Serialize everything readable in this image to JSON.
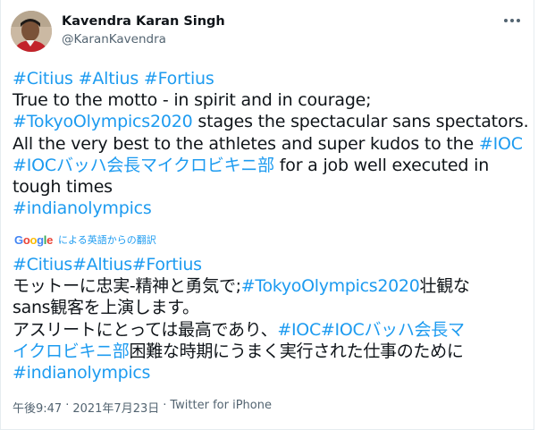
{
  "author": {
    "name": "Kavendra Karan Singh",
    "handle": "@KaranKavendra",
    "avatar_icon": "profile-photo",
    "avatar_colors": [
      "#c9b8a6",
      "#6b4a35",
      "#c2232b",
      "#222222"
    ]
  },
  "more_icon": "more-horizontal-icon",
  "tweet": {
    "lines": [
      [
        {
          "t": "#Citius",
          "tag": true
        },
        {
          "t": " ",
          "tag": false
        },
        {
          "t": "#Altius",
          "tag": true
        },
        {
          "t": " ",
          "tag": false
        },
        {
          "t": "#Fortius",
          "tag": true
        }
      ],
      [
        {
          "t": "True to the motto - in spirit and in courage;",
          "tag": false
        }
      ],
      [
        {
          "t": "#TokyoOlympics2020",
          "tag": true
        },
        {
          "t": " stages the spectacular sans spectators.",
          "tag": false
        }
      ],
      [
        {
          "t": "All the very best to the athletes and super kudos to the ",
          "tag": false
        },
        {
          "t": "#IOC",
          "tag": true
        }
      ],
      [
        {
          "t": "#IOCバッハ会長マイクロビキニ部",
          "tag": true
        },
        {
          "t": " for a job well executed in",
          "tag": false
        }
      ],
      [
        {
          "t": "tough times",
          "tag": false
        }
      ],
      [
        {
          "t": "#indianolympics",
          "tag": true
        }
      ]
    ]
  },
  "translation": {
    "provider": "Google",
    "label": "による英語からの翻訳",
    "lines": [
      [
        {
          "t": "#Citius#Altius#Fortius",
          "tag": true
        }
      ],
      [
        {
          "t": "モットーに忠実-精神と勇気で;",
          "tag": false
        },
        {
          "t": "#TokyoOlympics2020",
          "tag": true
        },
        {
          "t": "壮観な",
          "tag": false
        }
      ],
      [
        {
          "t": "sans観客を上演します。",
          "tag": false
        }
      ],
      [
        {
          "t": "アスリートにとっては最高であり、",
          "tag": false
        },
        {
          "t": "#IOC#IOCバッハ会長マ",
          "tag": true
        }
      ],
      [
        {
          "t": "イクロビキニ部",
          "tag": true
        },
        {
          "t": "困難な時期にうまく実行された仕事のために",
          "tag": false
        }
      ],
      [
        {
          "t": "#indianolympics",
          "tag": true
        }
      ]
    ]
  },
  "meta": {
    "time": "午後9:47",
    "sep1": "·",
    "date": "2021年7月23日",
    "sep2": "·",
    "source": "Twitter for iPhone"
  },
  "colors": {
    "link": "#1d9bf0",
    "text": "#0f1419",
    "secondary": "#536471"
  }
}
